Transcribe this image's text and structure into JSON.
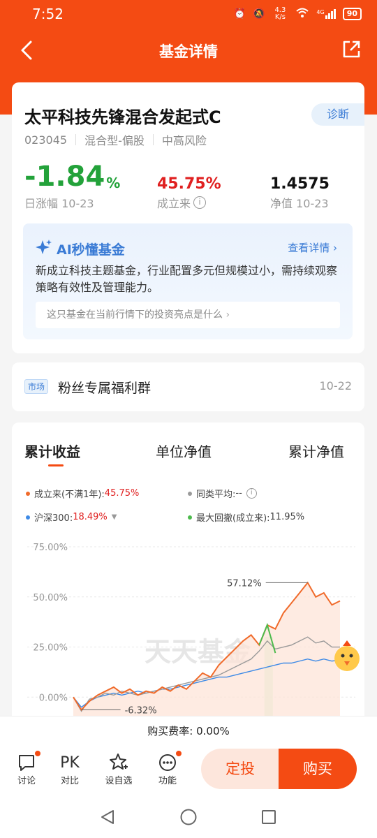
{
  "status": {
    "time": "7:52",
    "net_speed": "4.3 K/s",
    "signal": "4G",
    "battery": "90"
  },
  "nav": {
    "title": "基金详情"
  },
  "fund": {
    "name": "太平科技先锋混合发起式C",
    "diagnose_label": "诊断",
    "code": "023045",
    "type": "混合型-偏股",
    "risk": "中高风险",
    "daily_change": "-1.84",
    "daily_change_unit": "%",
    "daily_change_label": "日涨幅 10-23",
    "since_inception": "45.75%",
    "since_inception_label": "成立来",
    "nav_value": "1.4575",
    "nav_label": "净值 10-23"
  },
  "ai": {
    "title": "AI秒懂基金",
    "more": "查看详情",
    "description": "新成立科技主题基金，行业配置多元但规模过小，需持续观察策略有效性及管理能力。",
    "question": "这只基金在当前行情下的投资亮点是什么"
  },
  "market": {
    "tag": "市场",
    "text": "粉丝专属福利群",
    "date": "10-22"
  },
  "chart_tabs": [
    "累计收益",
    "单位净值",
    "累计净值"
  ],
  "legend": {
    "fund_label": "成立来(不满1年):",
    "fund_value": "45.75%",
    "peer_label": "同类平均:",
    "peer_value": "--",
    "index_label": "沪深300:",
    "index_value": "18.49%",
    "drawdown_label": "最大回撤(成立来):",
    "drawdown_value": "11.95%"
  },
  "chart_data": {
    "type": "line",
    "yticks": [
      "75.00%",
      "50.00%",
      "25.00%",
      "0.00%"
    ],
    "ylim": [
      -10,
      75
    ],
    "watermark": "天天基金",
    "annotations": {
      "max": "57.12%",
      "min": "-6.32%"
    },
    "series": [
      {
        "name": "成立来",
        "color": "#f06a2a",
        "values": [
          0,
          -6.3,
          -2,
          1,
          3,
          5,
          2,
          4,
          1,
          3,
          2,
          5,
          3,
          6,
          4,
          8,
          12,
          10,
          16,
          20,
          24,
          28,
          31,
          26,
          36,
          34,
          42,
          47,
          52,
          57.1,
          50,
          52,
          46,
          48
        ]
      },
      {
        "name": "同类平均",
        "color": "#9a9a9a",
        "values": [
          0,
          -7,
          -1,
          0,
          2,
          1,
          3,
          2,
          1,
          2,
          3,
          4,
          5,
          6,
          7,
          8,
          9,
          10,
          11,
          13,
          15,
          17,
          19,
          23,
          28,
          24,
          25,
          26,
          28,
          30,
          27,
          28,
          25,
          25
        ]
      },
      {
        "name": "沪深300",
        "color": "#3d8ae6",
        "values": [
          0,
          -5,
          -2,
          0,
          1,
          2,
          1,
          2,
          3,
          2,
          3,
          4,
          4,
          5,
          6,
          7,
          8,
          9,
          10,
          10,
          11,
          12,
          13,
          14,
          15,
          16,
          17,
          17,
          18,
          19,
          18,
          19,
          18,
          18.5
        ]
      }
    ]
  },
  "fee": {
    "label": "购买费率:",
    "value": "0.00%"
  },
  "bottom": {
    "comment": "讨论",
    "pk_icon": "PK",
    "compare": "对比",
    "watch": "设自选",
    "functions": "功能",
    "dingtou": "定投",
    "buy": "购买"
  }
}
